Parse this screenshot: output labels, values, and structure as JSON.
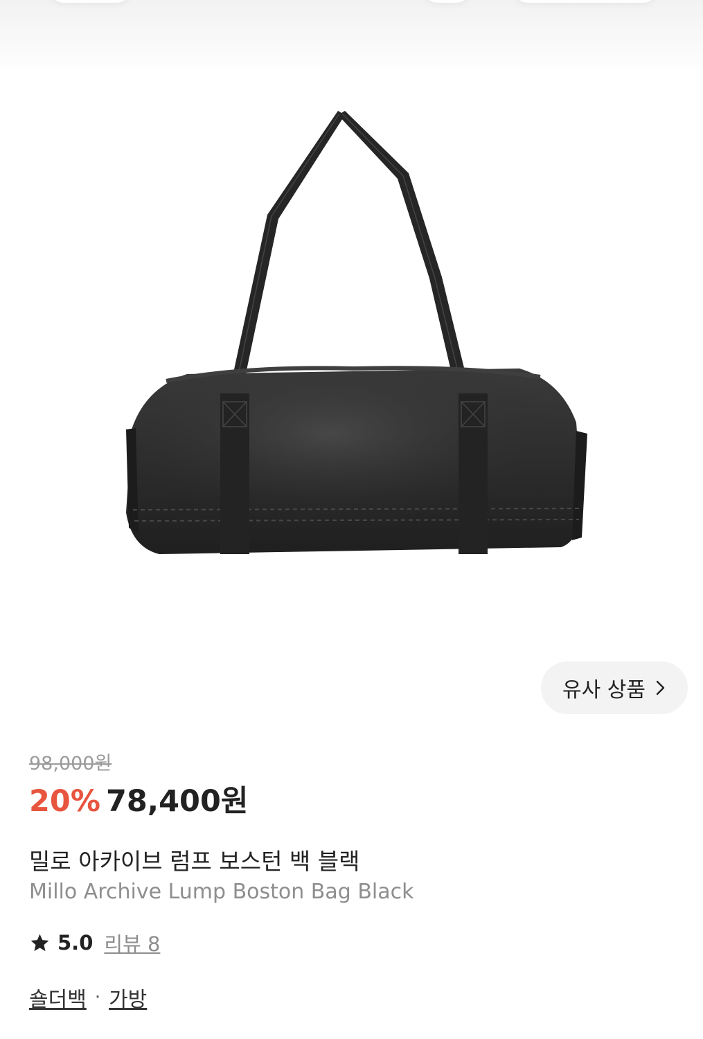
{
  "similar": {
    "label": "유사 상품"
  },
  "pricing": {
    "original": "98,000원",
    "discount": "20%",
    "price": "78,400원"
  },
  "product": {
    "name_ko": "밀로 아카이브 럼프 보스턴 백 블랙",
    "name_en": "Millo Archive Lump Boston Bag Black",
    "image_desc": "black nylon boston bag with long shoulder straps"
  },
  "rating": {
    "score": "5.0",
    "reviews_label": "리뷰 8"
  },
  "categories": {
    "items": [
      "숄더백",
      "가방"
    ],
    "separator": "·"
  },
  "colors": {
    "discount": "#e8553f",
    "bag": "#2b2b2b"
  }
}
